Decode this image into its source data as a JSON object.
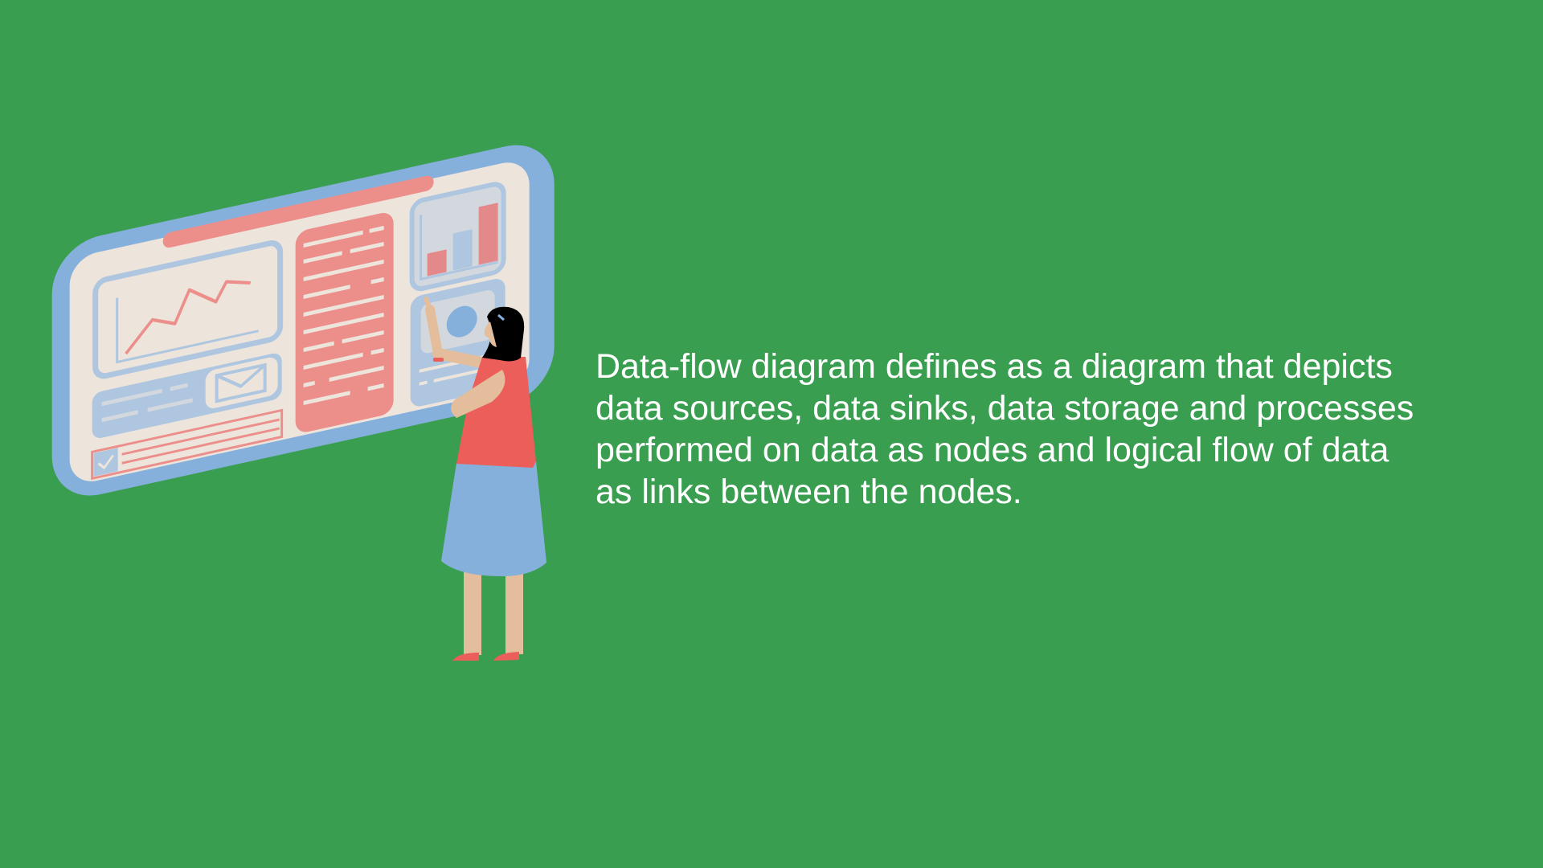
{
  "description": {
    "lines": [
      "Data-flow diagram defines as a diagram that depicts",
      "data sources, data sinks, data storage and processes",
      "performed on data as nodes and logical flow of data",
      "as links between the nodes."
    ]
  },
  "illustration": {
    "subject": "woman-at-dashboard-screen",
    "icons": [
      "line-chart-icon",
      "bar-chart-icon",
      "envelope-icon",
      "checkbox-icon",
      "globe-icon"
    ]
  },
  "colors": {
    "background": "#399e50",
    "screen_frame": "#86b0dc",
    "screen_bg": "#ede5dc",
    "accent_red": "#ec8f8b",
    "panel_blue": "#aec6df",
    "shirt": "#eb5e5a",
    "skin": "#e3bd9c",
    "text": "#ffffff"
  }
}
